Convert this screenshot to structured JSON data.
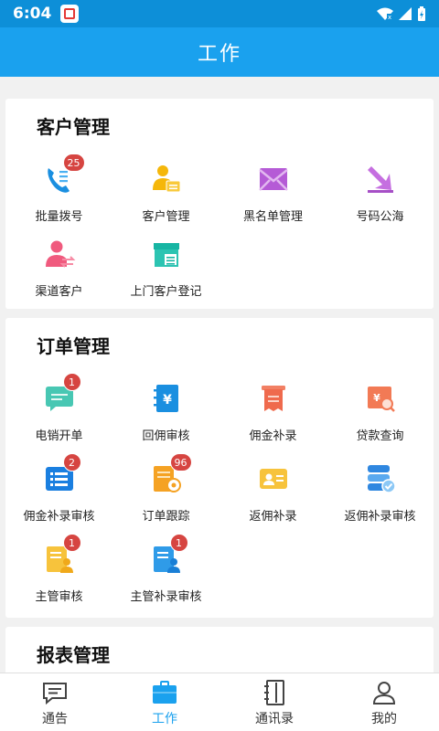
{
  "status": {
    "time": "6:04"
  },
  "header": {
    "title": "工作"
  },
  "sections": {
    "customer": {
      "title": "客户管理",
      "items": [
        {
          "label": "批量拨号",
          "badge": "25"
        },
        {
          "label": "客户管理"
        },
        {
          "label": "黑名单管理"
        },
        {
          "label": "号码公海"
        },
        {
          "label": "渠道客户"
        },
        {
          "label": "上门客户登记"
        }
      ]
    },
    "order": {
      "title": "订单管理",
      "items": [
        {
          "label": "电销开单",
          "badge": "1"
        },
        {
          "label": "回佣审核"
        },
        {
          "label": "佣金补录"
        },
        {
          "label": "贷款查询"
        },
        {
          "label": "佣金补录审核",
          "badge": "2"
        },
        {
          "label": "订单跟踪",
          "badge": "96"
        },
        {
          "label": "返佣补录"
        },
        {
          "label": "返佣补录审核"
        },
        {
          "label": "主管审核",
          "badge": "1"
        },
        {
          "label": "主管补录审核",
          "badge": "1"
        }
      ]
    },
    "report": {
      "title": "报表管理"
    }
  },
  "tabs": [
    {
      "label": "通告",
      "icon": "message-icon"
    },
    {
      "label": "工作",
      "icon": "briefcase-icon",
      "active": true
    },
    {
      "label": "通讯录",
      "icon": "contacts-book-icon"
    },
    {
      "label": "我的",
      "icon": "user-icon"
    }
  ],
  "colors": {
    "primary": "#1aa1ee",
    "statusbar": "#0d8fd8",
    "badge": "#d64541"
  }
}
